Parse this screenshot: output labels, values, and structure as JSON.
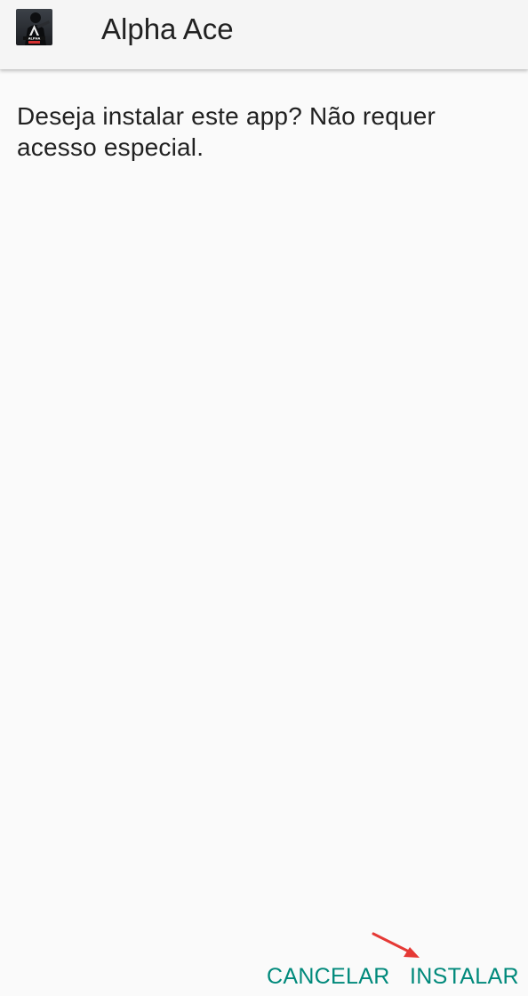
{
  "header": {
    "app_icon": "alpha-ace-app-icon",
    "app_icon_label": "ALPHA",
    "title": "Alpha Ace"
  },
  "dialog": {
    "message": "Deseja instalar este app? Não requer acesso especial."
  },
  "buttons": {
    "cancel_label": "CANCELAR",
    "install_label": "INSTALAR"
  },
  "annotation": {
    "arrow_icon": "red-arrow-icon",
    "arrow_color": "#e53935",
    "points_to": "INSTALAR"
  },
  "colors": {
    "accent": "#00897b",
    "text_primary": "#212121",
    "background": "#fafafa",
    "header_background": "#f5f5f5"
  }
}
